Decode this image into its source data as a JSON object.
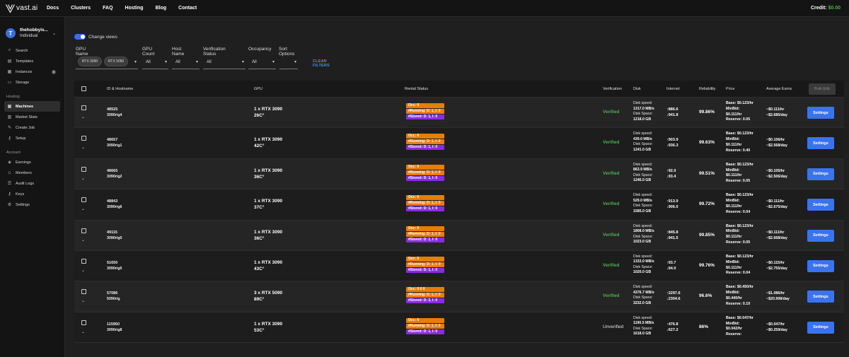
{
  "brand": {
    "name": "vast.ai"
  },
  "topnav": [
    "Docs",
    "Clusters",
    "FAQ",
    "Hosting",
    "Blog",
    "Contact"
  ],
  "credit": {
    "label": "Credit:",
    "amount": "$0.00"
  },
  "account": {
    "initial": "T",
    "name": "thehobbyis...",
    "role": "Individual"
  },
  "sidebar": {
    "main": [
      {
        "label": "Search",
        "icon": "search-icon"
      },
      {
        "label": "Templates",
        "icon": "template-icon"
      },
      {
        "label": "Instances",
        "icon": "instances-icon",
        "badge": "2"
      },
      {
        "label": "Storage",
        "icon": "storage-icon"
      }
    ],
    "hosting_title": "Hosting",
    "hosting": [
      {
        "label": "Machines",
        "icon": "machines-icon",
        "active": true
      },
      {
        "label": "Market Stats",
        "icon": "chart-icon"
      },
      {
        "label": "Create Job",
        "icon": "edit-icon"
      },
      {
        "label": "Setup",
        "icon": "key-icon"
      }
    ],
    "account_title": "Account",
    "account": [
      {
        "label": "Earnings",
        "icon": "earnings-icon"
      },
      {
        "label": "Members",
        "icon": "members-icon"
      },
      {
        "label": "Audit Logs",
        "icon": "audit-icon"
      },
      {
        "label": "Keys",
        "icon": "key-icon"
      },
      {
        "label": "Settings",
        "icon": "gear-icon"
      }
    ]
  },
  "toggle": {
    "label": "Change views"
  },
  "filters": {
    "gpu_name": {
      "label": "GPU Name",
      "chips": [
        "RTX 3090",
        "RTX 5090"
      ]
    },
    "gpu_count": {
      "label": "GPU Count",
      "value": "All"
    },
    "host_name": {
      "label": "Host Name",
      "value": "All"
    },
    "verification": {
      "label": "Verification Status",
      "value": "All"
    },
    "occupancy": {
      "label": "Occupancy",
      "value": "All"
    },
    "sort": {
      "label": "Sort Options",
      "value": ""
    },
    "clear": "CLEAR FILTERS"
  },
  "table": {
    "headers": {
      "id": "ID & Hostname",
      "gpu": "GPU",
      "rental": "Rental Status",
      "verification": "Verification",
      "disk": "Disk",
      "internet": "Internet",
      "reliability": "Reliability",
      "price": "Price",
      "earns": "Average Earns",
      "bulk": "Bulk Edit"
    },
    "rows": [
      {
        "id": "48525",
        "host": "3090rig4",
        "gpu": "1 x RTX 3090",
        "temp": "26C°",
        "occ": "Occ: 0",
        "run": "#Running: D: 1, I: 0",
        "sto": "#Stored: D: 1, I: 0",
        "verif": "Verified",
        "disk_speed": "1317.0 MB/s",
        "disk_space": "1218.0 GB",
        "up": "↑886.6",
        "down": "↓941.8",
        "rel": "99.86%",
        "base": "Base: $0.123/hr",
        "minbid": "$0.111/hr",
        "reserve": "Reserve: 0.05",
        "earn_hr": "~$0.111/hr",
        "earn_day": "~$2.685/day"
      },
      {
        "id": "48657",
        "host": "3090rig1",
        "gpu": "1 x RTX 3090",
        "temp": "42C°",
        "occ": "Occ: 0",
        "run": "#Running: D: 1, I: 0",
        "sto": "#Stored: D: 1, I: 0",
        "verif": "Verified",
        "disk_speed": "439.0 MB/s",
        "disk_space": "1241.0 GB",
        "up": "↑903.9",
        "down": "↓936.3",
        "rel": "99.63%",
        "base": "Base: $0.123/hr",
        "minbid": "$0.111/hr",
        "reserve": "Reserve: 0.40",
        "earn_hr": "~$0.106/hr",
        "earn_day": "~$2.568/day"
      },
      {
        "id": "48665",
        "host": "3090rig2",
        "gpu": "1 x RTX 3090",
        "temp": "36C°",
        "occ": "Occ: 0",
        "run": "#Running: D: 1, I: 0",
        "sto": "#Stored: D: 1, I: 0",
        "verif": "Verified",
        "disk_speed": "863.9 MB/s",
        "disk_space": "1246.0 GB",
        "up": "↑92.0",
        "down": "↓93.4",
        "rel": "99.51%",
        "base": "Base: $0.123/hr",
        "minbid": "$0.111/hr",
        "reserve": "Reserve: 0.05",
        "earn_hr": "~$0.105/hr",
        "earn_day": "~$2.506/day"
      },
      {
        "id": "48843",
        "host": "3090rig6",
        "gpu": "1 x RTX 3090",
        "temp": "37C°",
        "occ": "Occ: 0",
        "run": "#Running: D: 1, I: 0",
        "sto": "#Stored: D: 1, I: 0",
        "verif": "Verified",
        "disk_speed": "529.0 MB/s",
        "disk_space": "1585.0 GB",
        "up": "↑913.9",
        "down": "↓906.0",
        "rel": "99.72%",
        "base": "Base: $0.123/hr",
        "minbid": "$0.111/hr",
        "reserve": "Reserve: 0.04",
        "earn_hr": "~$0.111/hr",
        "earn_day": "~$2.675/day"
      },
      {
        "id": "49115",
        "host": "3090rig0",
        "gpu": "1 x RTX 3090",
        "temp": "36C°",
        "occ": "Occ: 0",
        "run": "#Running: D: 1, I: 0",
        "sto": "#Stored: D: 1, I: 0",
        "verif": "Verified",
        "disk_speed": "1808.0 MB/s",
        "disk_space": "1023.0 GB",
        "up": "↑845.8",
        "down": "↓941.5",
        "rel": "99.85%",
        "base": "Base: $0.123/hr",
        "minbid": "$0.111/hr",
        "reserve": "Reserve: 0.05",
        "earn_hr": "~$0.111/hr",
        "earn_day": "~$2.668/day"
      },
      {
        "id": "51650",
        "host": "3090rig5",
        "gpu": "1 x RTX 3090",
        "temp": "43C°",
        "occ": "Occ: 0",
        "run": "#Running: D: 1, I: 0",
        "sto": "#Stored: D: 1, I: 0",
        "verif": "Verified",
        "disk_speed": "1333.0 MB/s",
        "disk_space": "1020.0 GB",
        "up": "↑93.7",
        "down": "↓94.0",
        "rel": "99.76%",
        "base": "Base: $0.123/hr",
        "minbid": "$0.111/hr",
        "reserve": "Reserve: 0.04",
        "earn_hr": "~$0.115/hr",
        "earn_day": "~$2.755/day"
      },
      {
        "id": "57086",
        "host": "5090rig",
        "gpu": "3 x RTX 5090",
        "temp": "89C°",
        "occ": "Occ: 0 0 0",
        "run": "#Running: D: 1, I: 0",
        "sto": "#Stored: D: 3, I: 0",
        "verif": "Verified",
        "disk_speed": "4376.7 MB/s",
        "disk_space": "3232.0 GB",
        "up": "↑2297.6",
        "down": "↓2304.6",
        "rel": "96.6%",
        "base": "Base: $0.450/hr",
        "minbid": "$0.440/hr",
        "reserve": "Reserve: 0.10",
        "earn_hr": "~$1.086/hr",
        "earn_day": "~$20.908/day"
      },
      {
        "id": "115950",
        "host": "3090rig8",
        "gpu": "1 x RTX 3090",
        "temp": "53C°",
        "occ": "Occ: 0",
        "run": "#Running: D: 1, I: 0",
        "sto": "#Stored: D: 1, I: 0",
        "verif": "Unverified",
        "disk_speed": "1190.5 MB/s",
        "disk_space": "1618.0 GB",
        "up": "↑476.8",
        "down": "↓627.2",
        "rel": "86%",
        "base": "Base: $0.047/hr",
        "minbid": "$0.042/hr",
        "reserve": "Reserve:",
        "earn_hr": "~$0.047/hr",
        "earn_day": "~$0.259/day"
      }
    ],
    "labels": {
      "disk_speed": "Disk speed:",
      "disk_space": "Disk Space:",
      "minbid": "MinBid:",
      "settings": "Settings"
    }
  }
}
